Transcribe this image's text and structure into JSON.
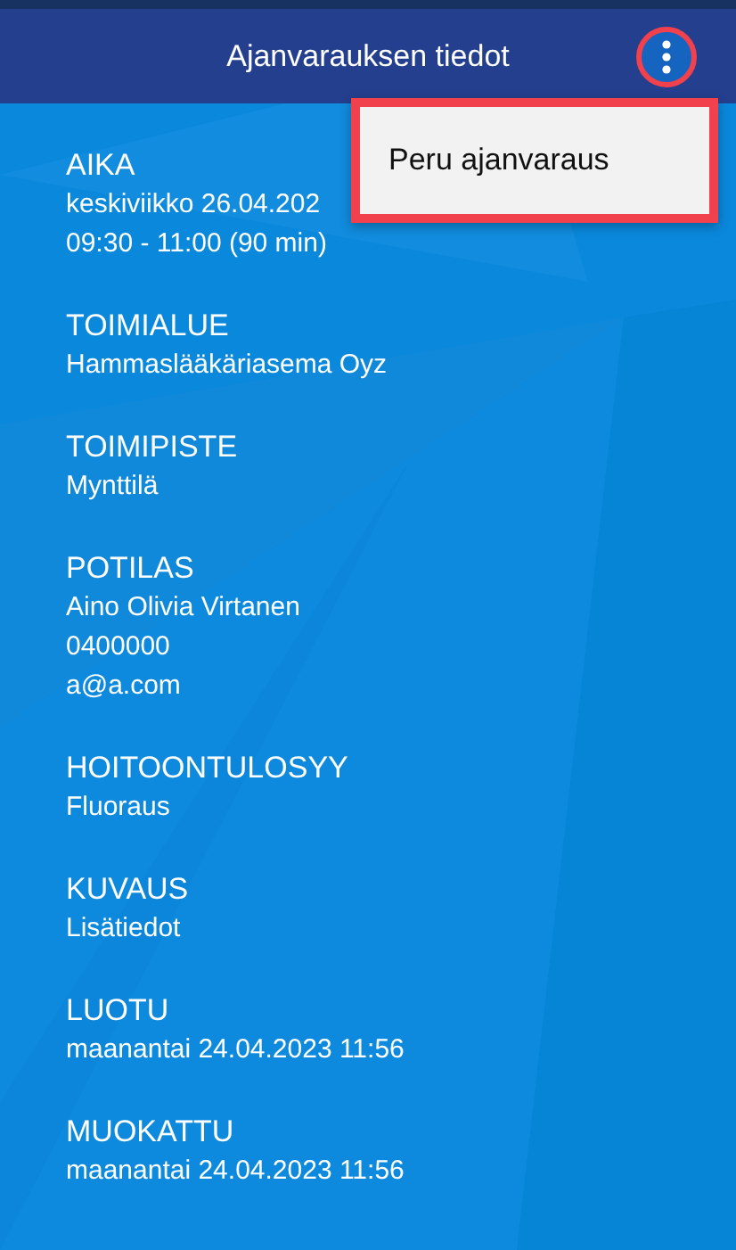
{
  "app_bar": {
    "title": "Ajanvarauksen tiedot",
    "menu_button": {
      "highlighted": true
    }
  },
  "menu": {
    "highlighted": true,
    "items": [
      {
        "label": "Peru ajanvaraus"
      }
    ]
  },
  "sections": [
    {
      "label": "AIKA",
      "lines": [
        "keskiviikko 26.04.202",
        "09:30 - 11:00 (90 min)"
      ]
    },
    {
      "label": "TOIMIALUE",
      "lines": [
        "Hammaslääkäriasema Oyz"
      ]
    },
    {
      "label": "TOIMIPISTE",
      "lines": [
        "Mynttilä"
      ]
    },
    {
      "label": "POTILAS",
      "lines": [
        "Aino Olivia Virtanen",
        "0400000",
        "a@a.com"
      ]
    },
    {
      "label": "HOITOONTULOSYY",
      "lines": [
        "Fluoraus"
      ]
    },
    {
      "label": "KUVAUS",
      "lines": [
        "Lisätiedot"
      ]
    },
    {
      "label": "LUOTU",
      "lines": [
        "maanantai 24.04.2023 11:56"
      ]
    },
    {
      "label": "MUOKATTU",
      "lines": [
        "maanantai 24.04.2023 11:56"
      ]
    }
  ]
}
